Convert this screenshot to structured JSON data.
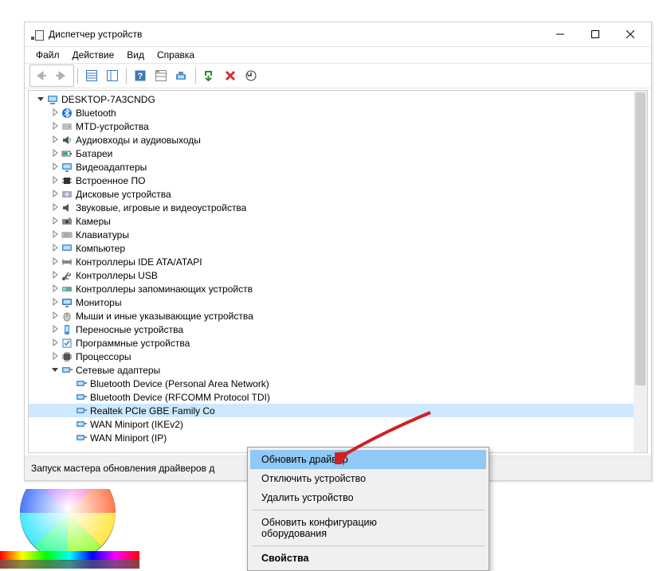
{
  "window": {
    "title": "Диспетчер устройств"
  },
  "menu": {
    "file": "Файл",
    "action": "Действие",
    "view": "Вид",
    "help": "Справка"
  },
  "tree": {
    "root": "DESKTOP-7A3CNDG",
    "categories": [
      "Bluetooth",
      "MTD-устройства",
      "Аудиовходы и аудиовыходы",
      "Батареи",
      "Видеоадаптеры",
      "Встроенное ПО",
      "Дисковые устройства",
      "Звуковые, игровые и видеоустройства",
      "Камеры",
      "Клавиатуры",
      "Компьютер",
      "Контроллеры IDE ATA/ATAPI",
      "Контроллеры USB",
      "Контроллеры запоминающих устройств",
      "Мониторы",
      "Мыши и иные указывающие устройства",
      "Переносные устройства",
      "Программные устройства",
      "Процессоры"
    ],
    "net_label": "Сетевые адаптеры",
    "net_items": [
      "Bluetooth Device (Personal Area Network)",
      "Bluetooth Device (RFCOMM Protocol TDI)",
      "Realtek PCIe GBE Family Co",
      "WAN Miniport (IKEv2)",
      "WAN Miniport (IP)"
    ],
    "selected": 2
  },
  "context_menu": {
    "items": [
      "Обновить драйвер",
      "Отключить устройство",
      "Удалить устройство",
      "Обновить конфигурацию оборудования",
      "Свойства"
    ]
  },
  "statusbar": "Запуск мастера обновления драйверов д"
}
